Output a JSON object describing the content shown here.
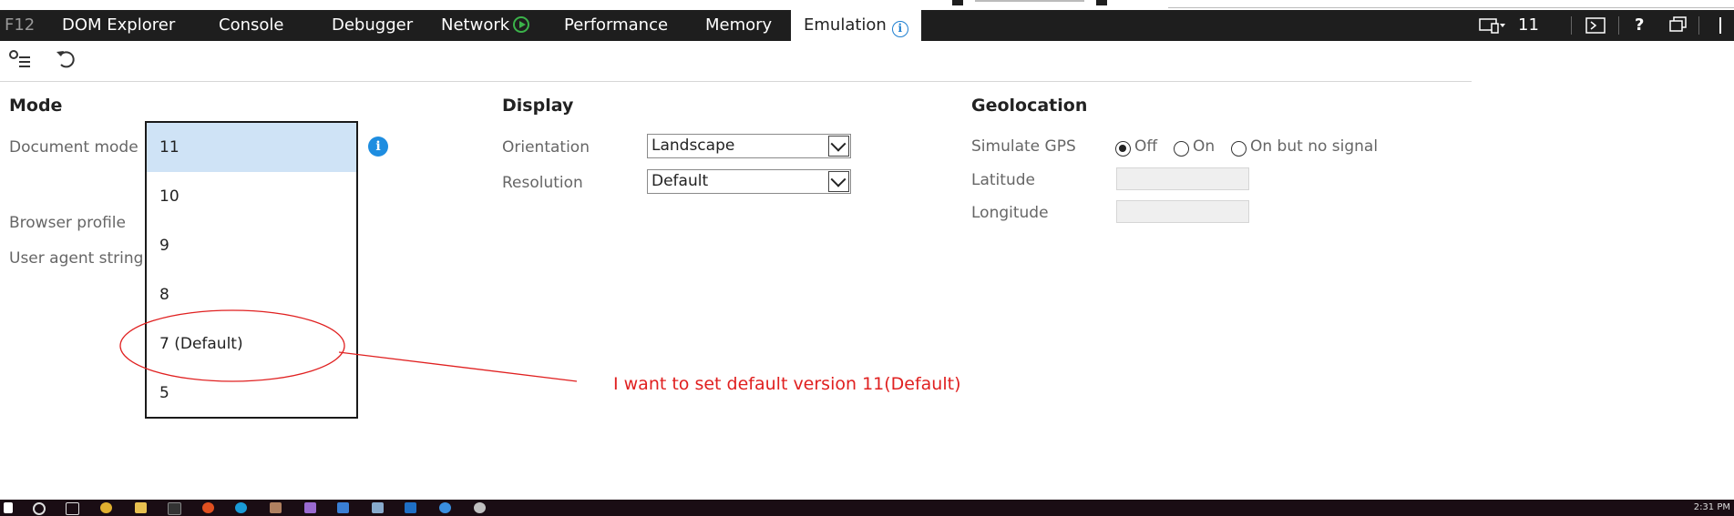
{
  "tabbar": {
    "f12": "F12",
    "tabs": [
      "DOM Explorer",
      "Console",
      "Debugger",
      "Network",
      "Performance",
      "Memory",
      "Emulation"
    ],
    "active_tab": "Emulation",
    "document_mode_indicator": "11",
    "help": "?"
  },
  "mode": {
    "heading": "Mode",
    "document_mode_label": "Document mode",
    "browser_profile_label": "Browser profile",
    "user_agent_label": "User agent string",
    "document_mode_options": [
      "11",
      "10",
      "9",
      "8",
      "7 (Default)",
      "5"
    ],
    "selected": "11",
    "info_glyph": "i"
  },
  "display": {
    "heading": "Display",
    "orientation_label": "Orientation",
    "orientation_value": "Landscape",
    "resolution_label": "Resolution",
    "resolution_value": "Default"
  },
  "geolocation": {
    "heading": "Geolocation",
    "simulate_gps_label": "Simulate GPS",
    "gps_options": [
      "Off",
      "On",
      "On but no signal"
    ],
    "gps_selected": "Off",
    "latitude_label": "Latitude",
    "longitude_label": "Longitude",
    "latitude_value": "",
    "longitude_value": ""
  },
  "annotation": {
    "text": "I want to set default version 11(Default)",
    "color": "#e02020"
  },
  "taskbar": {
    "clock": "2:31 PM"
  },
  "colors": {
    "tabbar_bg": "#1e1e1e",
    "selection": "#cfe3f6",
    "info_blue": "#1e8de0",
    "annotation": "#e02020"
  }
}
